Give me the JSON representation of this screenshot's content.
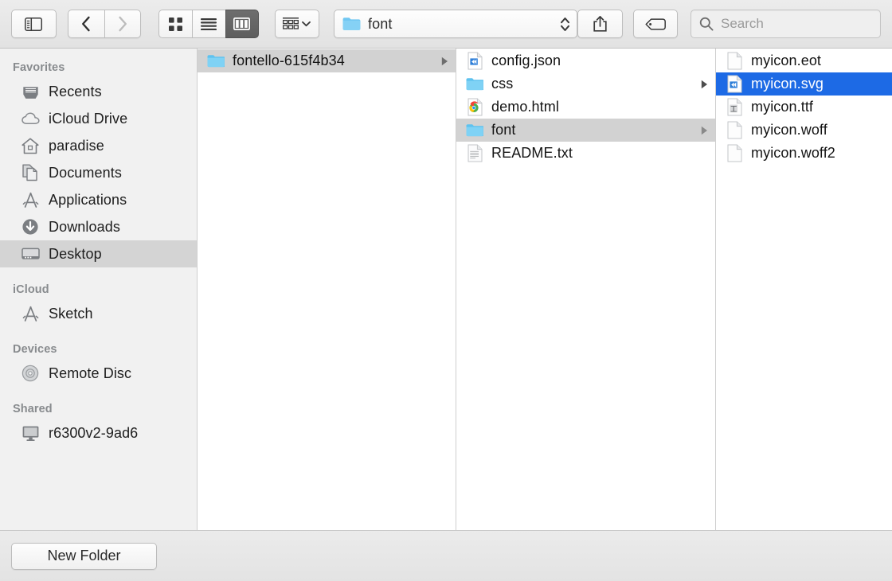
{
  "window": {
    "title": "font"
  },
  "toolbar": {
    "sidebar_toggle": "sidebar-toggle-icon",
    "back_label": "Back",
    "forward_label": "Forward",
    "view_icon": "icon-view",
    "view_list": "list-view",
    "view_column": "column-view",
    "arrange_label": "Arrange",
    "path_label": "font",
    "share_label": "Share",
    "tags_label": "Tags",
    "search": {
      "value": "",
      "placeholder": "Search"
    }
  },
  "sidebar": {
    "sections": [
      {
        "header": "Favorites",
        "items": [
          {
            "label": "Recents",
            "icon": "recents-icon",
            "selected": false
          },
          {
            "label": "iCloud Drive",
            "icon": "cloud-icon",
            "selected": false
          },
          {
            "label": "paradise",
            "icon": "home-icon",
            "selected": false
          },
          {
            "label": "Documents",
            "icon": "documents-icon",
            "selected": false
          },
          {
            "label": "Applications",
            "icon": "applications-icon",
            "selected": false
          },
          {
            "label": "Downloads",
            "icon": "downloads-icon",
            "selected": false
          },
          {
            "label": "Desktop",
            "icon": "desktop-icon",
            "selected": true
          }
        ]
      },
      {
        "header": "iCloud",
        "items": [
          {
            "label": "Sketch",
            "icon": "applications-icon",
            "selected": false
          }
        ]
      },
      {
        "header": "Devices",
        "items": [
          {
            "label": "Remote Disc",
            "icon": "disc-icon",
            "selected": false
          }
        ]
      },
      {
        "header": "Shared",
        "items": [
          {
            "label": "r6300v2-9ad6",
            "icon": "display-icon",
            "selected": false
          }
        ]
      }
    ]
  },
  "columns": [
    {
      "name": "column-1",
      "rows": [
        {
          "label": "fontello-615f4b34",
          "icon": "folder-icon",
          "arrow": true,
          "selection": "inactive"
        }
      ]
    },
    {
      "name": "column-2",
      "rows": [
        {
          "label": "config.json",
          "icon": "code-file-icon",
          "arrow": false,
          "selection": "none"
        },
        {
          "label": "css",
          "icon": "folder-icon",
          "arrow": true,
          "selection": "none"
        },
        {
          "label": "demo.html",
          "icon": "chrome-file-icon",
          "arrow": false,
          "selection": "none"
        },
        {
          "label": "font",
          "icon": "folder-icon",
          "arrow": true,
          "selection": "inactive"
        },
        {
          "label": "README.txt",
          "icon": "text-file-icon",
          "arrow": false,
          "selection": "none"
        }
      ]
    },
    {
      "name": "column-3",
      "rows": [
        {
          "label": "myicon.eot",
          "icon": "blank-file-icon",
          "arrow": false,
          "selection": "none"
        },
        {
          "label": "myicon.svg",
          "icon": "code-file-icon",
          "arrow": false,
          "selection": "active"
        },
        {
          "label": "myicon.ttf",
          "icon": "font-file-icon",
          "arrow": false,
          "selection": "none"
        },
        {
          "label": "myicon.woff",
          "icon": "blank-file-icon",
          "arrow": false,
          "selection": "none"
        },
        {
          "label": "myicon.woff2",
          "icon": "blank-file-icon",
          "arrow": false,
          "selection": "none"
        }
      ]
    }
  ],
  "bottombar": {
    "new_folder_label": "New Folder"
  },
  "colors": {
    "selection_blue": "#1d6ae5",
    "selection_gray": "#d2d2d2",
    "sidebar_bg": "#f1f1f1",
    "folder_blue": "#6fc7f2",
    "toolbar_active": "#6e6e6e"
  }
}
